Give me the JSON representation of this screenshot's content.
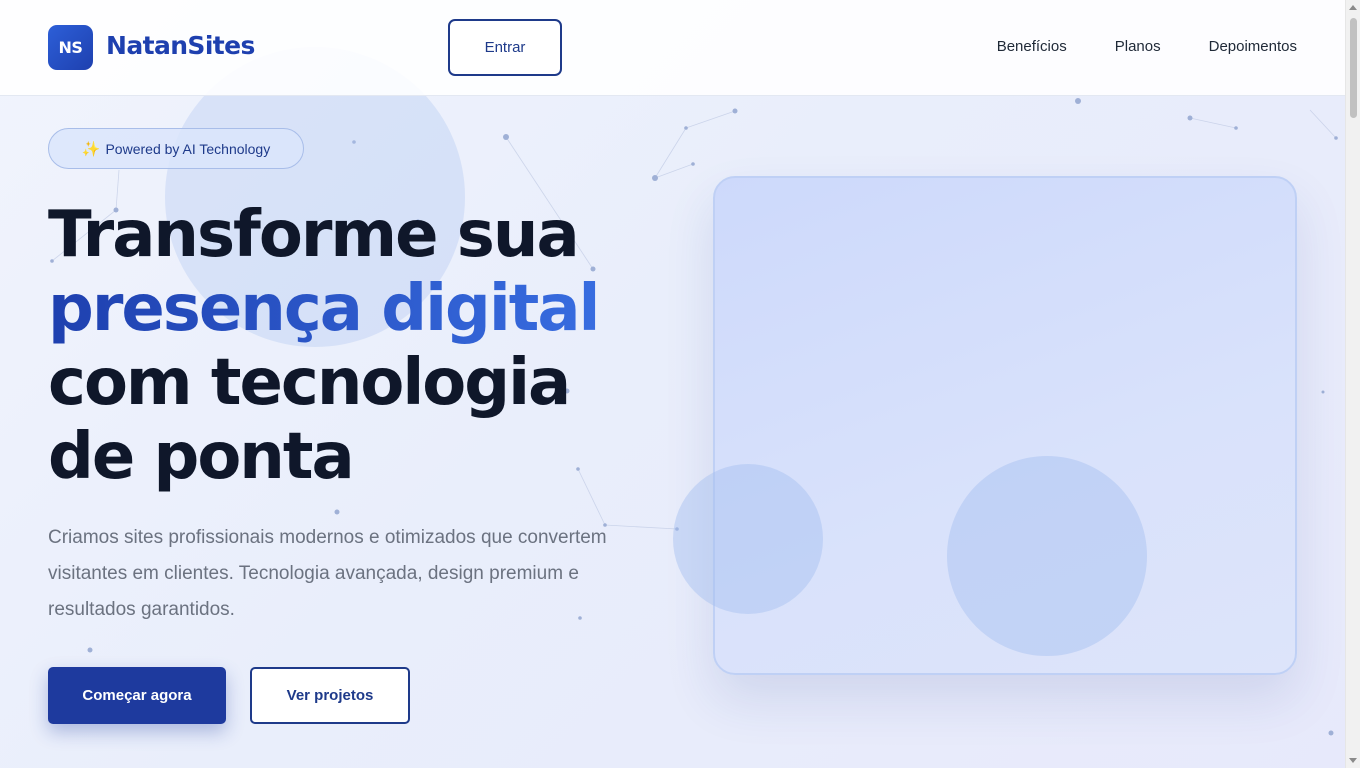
{
  "header": {
    "logo_initials": "NS",
    "brand_name": "NatanSites",
    "login_button": "Entrar",
    "nav": [
      {
        "label": "Benefícios"
      },
      {
        "label": "Planos"
      },
      {
        "label": "Depoimentos"
      }
    ]
  },
  "hero": {
    "badge_icon": "sparkles-icon",
    "badge": "Powered by AI Technology",
    "title_line1": "Transforme sua",
    "title_line2": "presença digital",
    "title_line3": "com tecnologia",
    "title_line4": "de ponta",
    "description": "Criamos sites profissionais modernos e otimizados que convertem visitantes em clientes. Tecnologia avançada, design premium e resultados garantidos.",
    "primary_button": "Começar agora",
    "secondary_button": "Ver projetos"
  },
  "colors": {
    "brand": "#1e40af",
    "accent": "#3b72e6",
    "text_dark": "#0f172a",
    "text_muted": "#6b7280"
  }
}
